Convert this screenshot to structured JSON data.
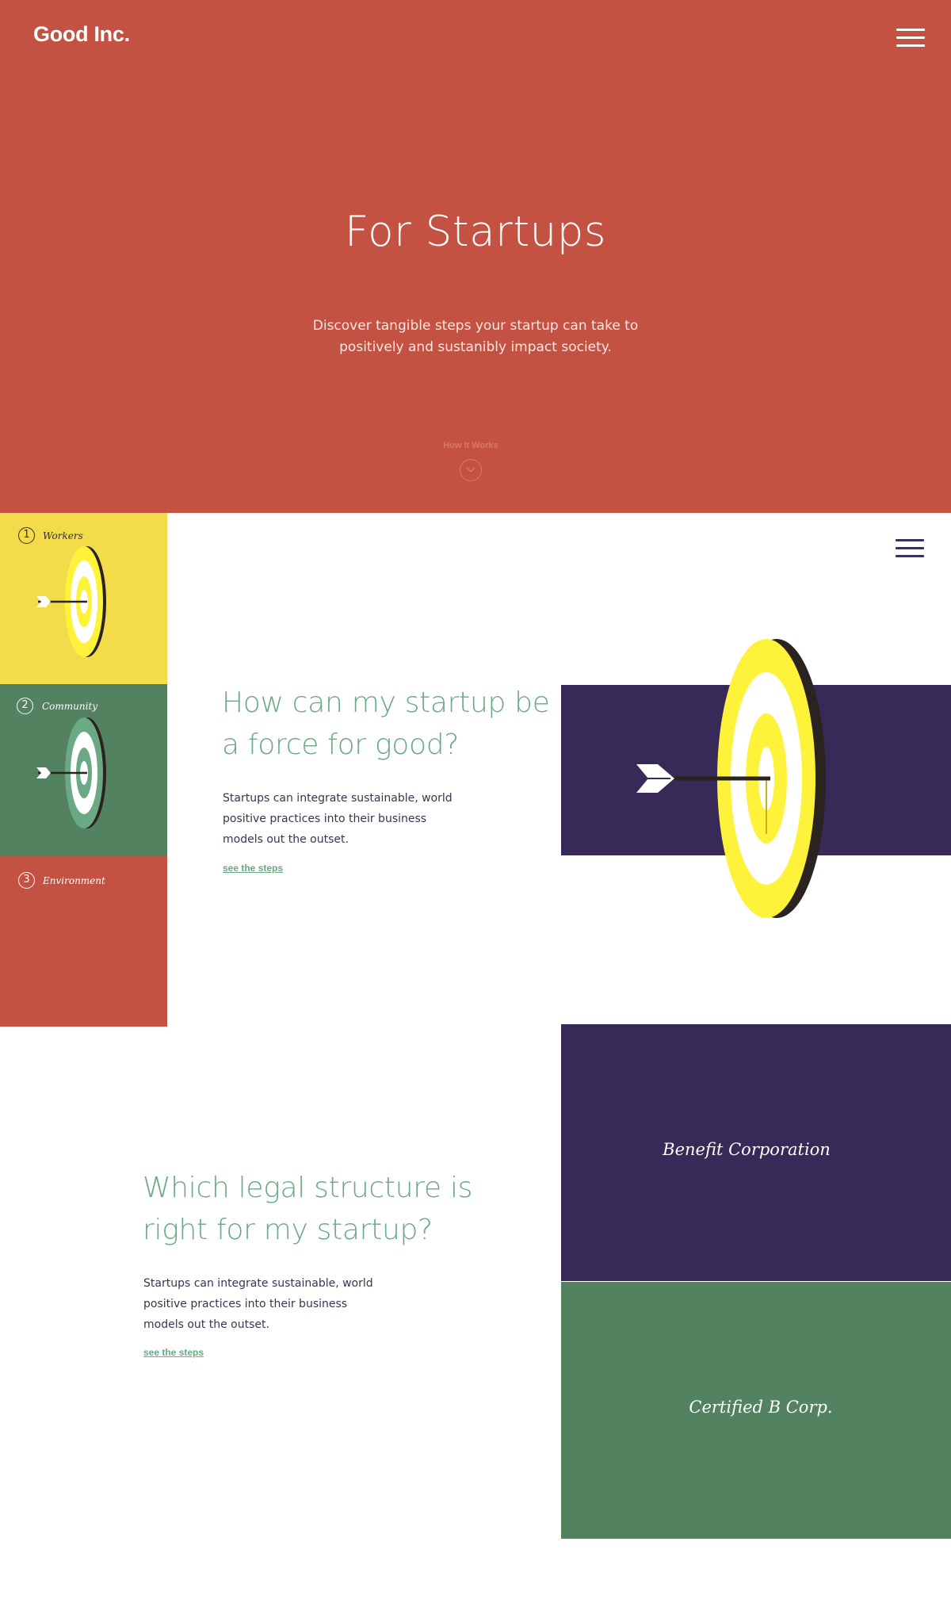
{
  "brand": {
    "logo": "Good Inc."
  },
  "colors": {
    "red": "#c45242",
    "yellow": "#f3dc4a",
    "green": "#52825f",
    "purple": "#372a58",
    "accent_green": "#6aa983"
  },
  "hero": {
    "title": "For Startups",
    "description": "Discover tangible steps your startup can take to positively and sustanibly impact society.",
    "cta": "How It Works",
    "menu_icon": "hamburger-icon",
    "scroll_icon": "chevron-down-icon"
  },
  "steps": [
    {
      "number": "1",
      "label": "Workers"
    },
    {
      "number": "2",
      "label": "Community"
    },
    {
      "number": "3",
      "label": "Environment"
    }
  ],
  "section1": {
    "title": "How can my startup be a force for good?",
    "body": "Startups can integrate sustainable, world positive practices into their business models out the outset.",
    "link": "see the steps",
    "menu_icon": "hamburger-icon",
    "illustration": "target-arrow-icon"
  },
  "section2": {
    "title": "Which legal structure is right for my startup?",
    "body": "Startups can integrate sustainable, world positive practices into their business models out the outset.",
    "link": "see the steps",
    "cards": [
      {
        "label": "Benefit Corporation"
      },
      {
        "label": "Certified B Corp."
      }
    ]
  }
}
